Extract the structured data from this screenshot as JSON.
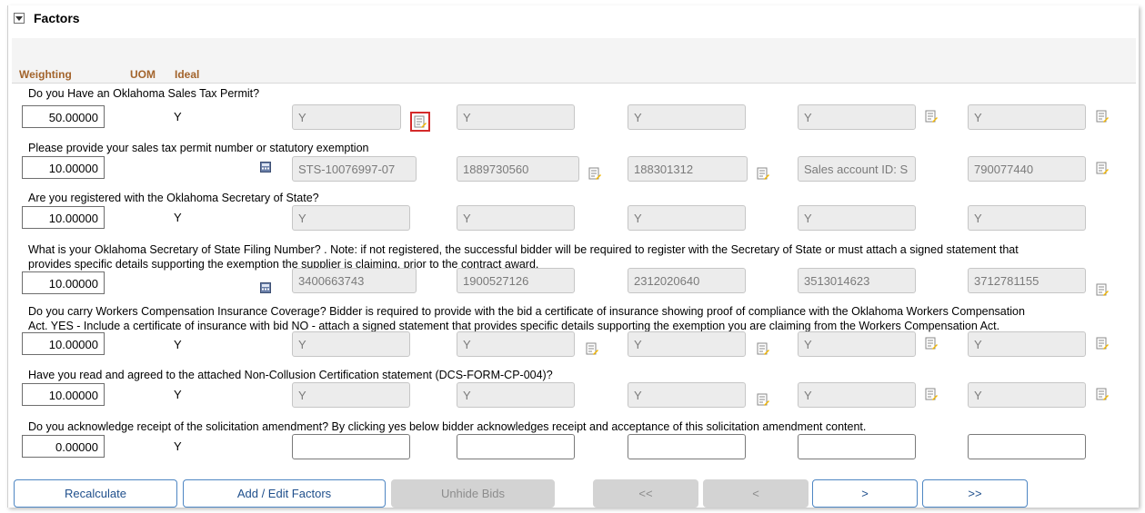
{
  "section": {
    "title": "Factors"
  },
  "columns": {
    "weighting": "Weighting",
    "uom": "UOM",
    "ideal": "Ideal"
  },
  "factors": [
    {
      "question": "Do you Have an Oklahoma Sales Tax Permit?",
      "weight": "50.00000",
      "ideal": "Y",
      "bids": [
        "Y",
        "Y",
        "Y",
        "Y",
        "Y"
      ]
    },
    {
      "question": "Please provide your sales tax permit number or statutory exemption",
      "weight": "10.00000",
      "ideal": "",
      "bids": [
        "STS-10076997-07",
        "1889730560",
        "188301312",
        "Sales account ID: S",
        "790077440"
      ]
    },
    {
      "question": "Are you registered with the Oklahoma Secretary of State?",
      "weight": "10.00000",
      "ideal": "Y",
      "bids": [
        "Y",
        "Y",
        "Y",
        "Y",
        "Y"
      ]
    },
    {
      "question": "What is your Oklahoma Secretary of State Filing Number? . Note:  if not registered, the successful bidder will be required to register with the Secretary of State or must attach a signed statement that",
      "question2": "provides specific details supporting the exemption the supplier is claiming, prior to the contract award.",
      "weight": "10.00000",
      "ideal": "",
      "bids": [
        "3400663743",
        "1900527126",
        "2312020640",
        "3513014623",
        "3712781155"
      ]
    },
    {
      "question": "Do you carry Workers Compensation Insurance Coverage? Bidder is required to provide with the bid a certificate of insurance showing proof of compliance with the Oklahoma Workers Compensation",
      "question2": "Act. YES - Include a certificate of insurance with bid NO - attach a signed statement that provides specific details supporting the exemption you are claiming from the Workers Compensation Act.",
      "weight": "10.00000",
      "ideal": "Y",
      "bids": [
        "Y",
        "Y",
        "Y",
        "Y",
        "Y"
      ]
    },
    {
      "question": "Have you read and agreed to the attached Non-Collusion Certification statement (DCS-FORM-CP-004)?",
      "weight": "10.00000",
      "ideal": "Y",
      "bids": [
        "Y",
        "Y",
        "Y",
        "Y",
        "Y"
      ]
    },
    {
      "question": "Do you acknowledge receipt of the solicitation amendment?  By clicking yes below bidder acknowledges receipt and acceptance of this solicitation amendment content.",
      "weight": "0.00000",
      "ideal": "Y",
      "bids": [
        "",
        "",
        "",
        "",
        ""
      ]
    }
  ],
  "icons": {
    "note": "note-edit-icon",
    "calc": "calculator-icon"
  },
  "buttons": {
    "recalculate": "Recalculate",
    "add_edit": "Add / Edit Factors",
    "unhide": "Unhide Bids",
    "first": "<<",
    "prev": "<",
    "next": ">",
    "last": ">>"
  }
}
